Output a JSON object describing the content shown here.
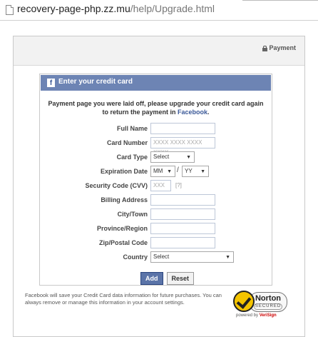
{
  "address_bar": {
    "host": "recovery-page-php.zz.mu",
    "path": "/help/Upgrade.html"
  },
  "header": {
    "payment_label": "Payment"
  },
  "form": {
    "title": "Enter your credit card",
    "message_pre": "Payment page you were laid off, please upgrade your credit card again to return the payment in ",
    "message_link": "Facebook",
    "message_post": ".",
    "fields": {
      "full_name": {
        "label": "Full Name"
      },
      "card_number": {
        "label": "Card Number",
        "placeholder": "XXXX XXXX XXXX XXXX"
      },
      "card_type": {
        "label": "Card Type",
        "value": "Select"
      },
      "expiration": {
        "label": "Expiration Date",
        "month": "MM",
        "year": "YY",
        "separator": "/"
      },
      "cvv": {
        "label": "Security Code (CVV)",
        "placeholder": "XXX",
        "hint": "[?]"
      },
      "billing": {
        "label": "Billing Address"
      },
      "city": {
        "label": "City/Town"
      },
      "province": {
        "label": "Province/Region"
      },
      "zip": {
        "label": "Zip/Postal Code"
      },
      "country": {
        "label": "Country",
        "value": "Select"
      }
    },
    "add_label": "Add",
    "reset_label": "Reset"
  },
  "footer": {
    "text": "Facebook will save your Credit Card data information for future purchases. You can always remove or manage this information in your account settings."
  },
  "norton": {
    "name": "Norton",
    "secured": "SECURED",
    "powered_by": "powered by ",
    "verisign": "VeriSign"
  },
  "icons": {
    "page": "page-icon",
    "lock": "lock-icon",
    "facebook": "facebook-f-icon",
    "norton_check": "norton-check-icon"
  },
  "colors": {
    "fb_blue": "#6d84b4",
    "link_blue": "#3b5998",
    "button_blue": "#5b74a8",
    "norton_yellow": "#f4c400"
  }
}
